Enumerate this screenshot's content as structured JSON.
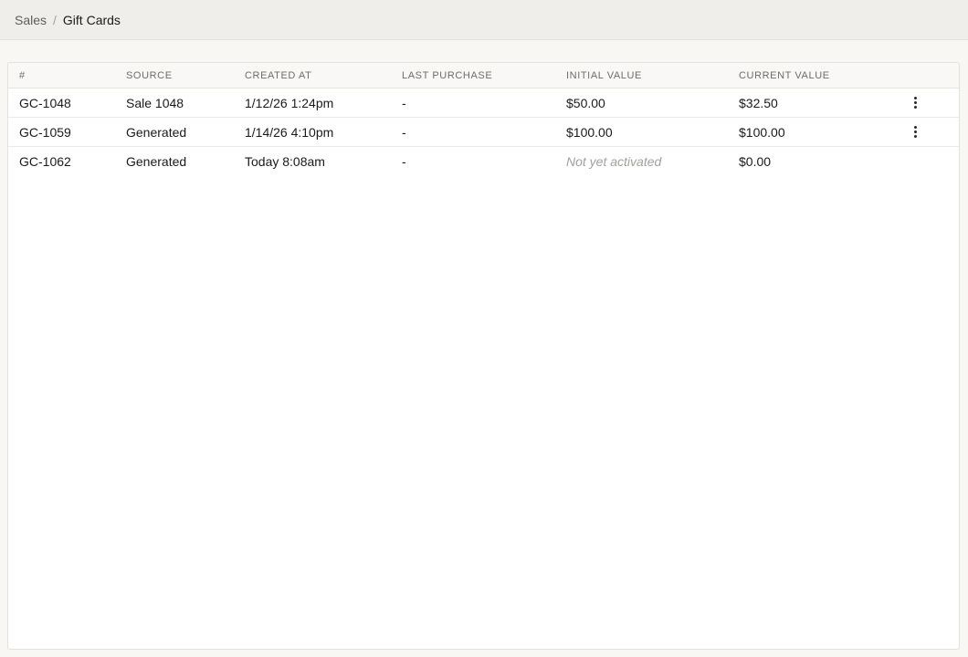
{
  "breadcrumb": {
    "parent": "Sales",
    "separator": "/",
    "current": "Gift Cards"
  },
  "table": {
    "columns": [
      "#",
      "Source",
      "Created At",
      "Last Purchase",
      "Initial Value",
      "Current Value"
    ],
    "rows": [
      {
        "id": "GC-1048",
        "source": "Sale 1048",
        "created_at": "1/12/26 1:24pm",
        "last_purchase": "-",
        "initial_value": "$50.00",
        "current_value": "$32.50",
        "has_menu": true
      },
      {
        "id": "GC-1059",
        "source": "Generated",
        "created_at": "1/14/26 4:10pm",
        "last_purchase": "-",
        "initial_value": "$100.00",
        "current_value": "$100.00",
        "has_menu": true
      },
      {
        "id": "GC-1062",
        "source": "Generated",
        "created_at": "Today 8:08am",
        "last_purchase": "-",
        "initial_value": "Not yet activated",
        "current_value": "$0.00",
        "has_menu": false
      }
    ]
  },
  "icons": {
    "row_menu": "more-vertical-icon"
  }
}
